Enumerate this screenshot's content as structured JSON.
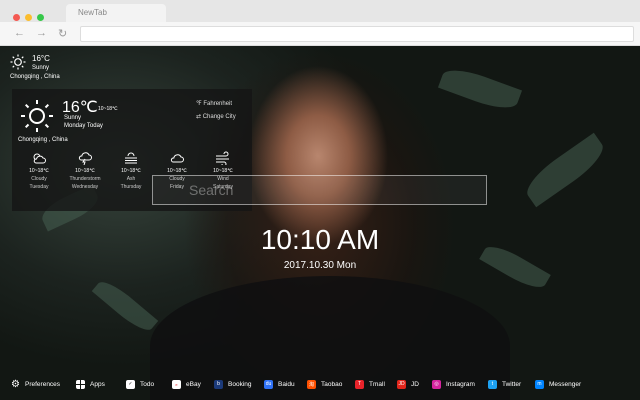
{
  "browser": {
    "tab_title": "NewTab",
    "dot_colors": [
      "#f45952",
      "#fbbd2e",
      "#36c84a"
    ]
  },
  "small_weather": {
    "temp": "16°C",
    "desc": "Sunny",
    "city": "Chongqing , China"
  },
  "weather_panel": {
    "temp": "16℃",
    "range": "10~18℃",
    "desc": "Sunny",
    "day": "Monday Today",
    "city": "Chongqing , China",
    "unit_option": "℉ Fahrenheit",
    "change_city": "⇄ Change City",
    "forecast": [
      {
        "icon": "partly-cloudy-icon",
        "range": "10~18℃",
        "cond": "Cloudy",
        "day": "Tuesday"
      },
      {
        "icon": "thunderstorm-icon",
        "range": "10~18℃",
        "cond": "Thunderstorm",
        "day": "Wednesday"
      },
      {
        "icon": "ash-icon",
        "range": "10~18℃",
        "cond": "Ash",
        "day": "Thursday"
      },
      {
        "icon": "cloud-icon",
        "range": "10~18℃",
        "cond": "Cloudy",
        "day": "Friday"
      },
      {
        "icon": "wind-icon",
        "range": "10~18℃",
        "cond": "Wind",
        "day": "Saturday"
      }
    ]
  },
  "search": {
    "placeholder": "Search"
  },
  "clock": {
    "time": "10:10 AM",
    "date": "2017.10.30 Mon"
  },
  "bottombar": {
    "items": [
      {
        "label": "Preferences",
        "icon": "gear-icon",
        "color": ""
      },
      {
        "label": "Apps",
        "icon": "grid-icon",
        "color": ""
      },
      {
        "label": "Todo",
        "icon": "checkbox-icon",
        "color": "#ffffff"
      },
      {
        "label": "eBay",
        "icon": "ebay-icon",
        "color": "#ffffff"
      },
      {
        "label": "Booking",
        "icon": "booking-icon",
        "color": "#1b3a7a"
      },
      {
        "label": "Baidu",
        "icon": "baidu-icon",
        "color": "#3072f6"
      },
      {
        "label": "Taobao",
        "icon": "taobao-icon",
        "color": "#ff5000"
      },
      {
        "label": "Tmall",
        "icon": "tmall-icon",
        "color": "#e8232a"
      },
      {
        "label": "JD",
        "icon": "jd-icon",
        "color": "#e1251b"
      },
      {
        "label": "Instagram",
        "icon": "instagram-icon",
        "color": "#d6249f"
      },
      {
        "label": "Twitter",
        "icon": "twitter-icon",
        "color": "#1da1f2"
      },
      {
        "label": "Messenger",
        "icon": "messenger-icon",
        "color": "#0084ff"
      }
    ]
  }
}
